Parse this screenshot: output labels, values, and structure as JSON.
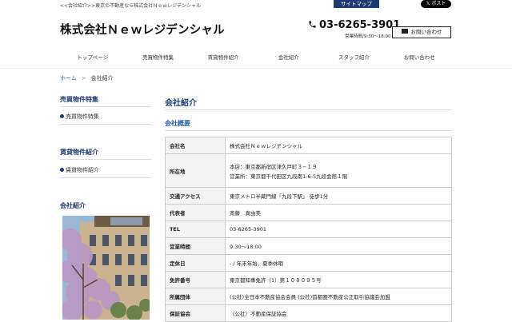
{
  "header": {
    "tagline": "<<会社紹介>>東京の不動産なら株式会社Ｎｅｗレジデンシャル",
    "sitemap_label": "サイトマップ",
    "x_post_label": "𝕏 ポスト",
    "logo": "株式会社Ｎｅｗレジデンシャル",
    "phone": "03-6265-3901",
    "hours": "営業時間/9:30〜18:00",
    "inquiry_label": "お問い合わせ"
  },
  "nav": {
    "items": [
      {
        "label": "トップページ"
      },
      {
        "label": "売買物件特集"
      },
      {
        "label": "賃貸物件紹介"
      },
      {
        "label": "会社紹介"
      },
      {
        "label": "スタッフ紹介"
      },
      {
        "label": "お問い合わせ"
      }
    ]
  },
  "breadcrumb": {
    "home": "ホーム",
    "separator": ">",
    "current": "会社紹介"
  },
  "sidebar": {
    "sections": [
      {
        "heading": "売買物件特集",
        "item": "売買物件特集"
      },
      {
        "heading": "賃貸物件紹介",
        "item": "賃貸物件紹介"
      },
      {
        "heading": "会社紹介"
      }
    ]
  },
  "main": {
    "title": "会社紹介",
    "subtitle": "会社概要",
    "rows": [
      {
        "key": "会社名",
        "value": "株式会社Ｎｅｗレジデンシャル"
      },
      {
        "key": "所在地",
        "value": "本店：東京都新宿区津久戸町３−１９",
        "value2": "営業所：東京都千代田区九段南1-6-5九段会館１階"
      },
      {
        "key": "交通アクセス",
        "value": "東京メトロ半蔵門線「九段下駅」 徒歩1分"
      },
      {
        "key": "代表者",
        "value": "斎藤　真由美"
      },
      {
        "key": "TEL",
        "value": "03-6265-3901"
      },
      {
        "key": "営業時間",
        "value": "9:30〜18:00"
      },
      {
        "key": "定休日",
        "value": "- / 年末年始、夏季休暇"
      },
      {
        "key": "免許番号",
        "value": "東京都知事免許（1）第１０８０９５号"
      },
      {
        "key": "所属団体",
        "value": "(公社)全日本不動産協会会員 (公社)首都圏不動産公正取引協議会加盟"
      },
      {
        "key": "保証協会",
        "value": "（公社）不動産保証協会"
      }
    ]
  },
  "colors": {
    "brand_navy": "#1f3a73",
    "link_blue": "#2b5ea8"
  }
}
